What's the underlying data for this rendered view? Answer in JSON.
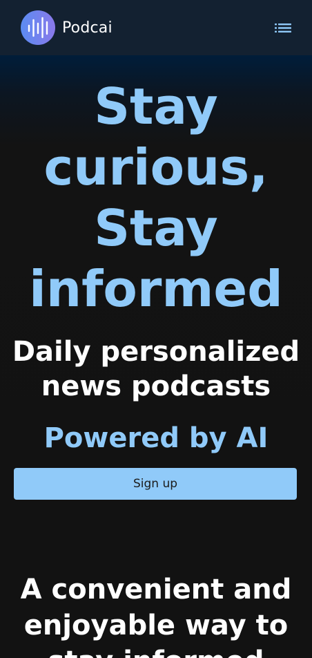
{
  "navbar": {
    "brand": "Podcai",
    "logo_icon": "soundwave-icon",
    "menu_icon": "list-menu-icon"
  },
  "hero": {
    "title": "Stay curious, Stay informed",
    "subtitle": "Daily personalized news podcasts",
    "tagline": "Powered by AI",
    "cta_label": "Sign up"
  },
  "features": {
    "heading": "A convenient and enjoyable way to stay informed"
  },
  "colors": {
    "accent": "#90caf9",
    "background": "#121212",
    "navbar": "#132131",
    "logo_gradient_start": "#5b8cf2",
    "logo_gradient_end": "#8a79ea"
  }
}
